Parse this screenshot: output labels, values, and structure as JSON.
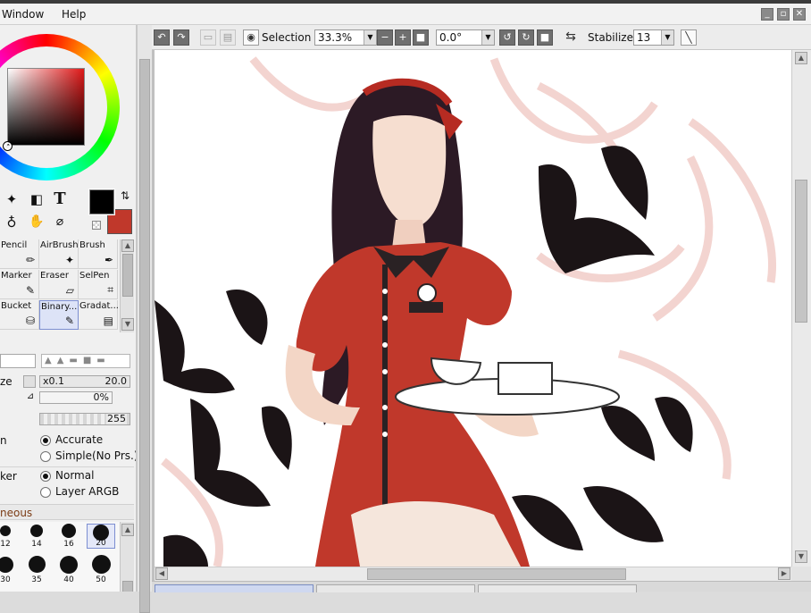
{
  "app": {
    "menu": [
      "Window",
      "Help"
    ],
    "window_buttons": [
      "_",
      "▫",
      "✕"
    ]
  },
  "toolbar": {
    "selection_label": "Selection",
    "zoom": "33.3%",
    "rotation": "0.0°",
    "stabilizer_label": "Stabilizer",
    "stabilizer_value": "13"
  },
  "tools": {
    "text_tool": "T",
    "tiles": [
      {
        "label": "Pencil",
        "icon": "✏"
      },
      {
        "label": "AirBrush",
        "icon": "✦"
      },
      {
        "label": "Brush",
        "icon": "✒"
      },
      {
        "label": "Marker",
        "icon": "✎"
      },
      {
        "label": "Eraser",
        "icon": "▱"
      },
      {
        "label": "SelPen",
        "icon": "⌗"
      },
      {
        "label": "Bucket",
        "icon": "⛁"
      },
      {
        "label": "Binary...",
        "icon": "✎"
      },
      {
        "label": "Gradat...",
        "icon": "▤"
      }
    ]
  },
  "brush_settings": {
    "size_label": "ze",
    "size_multiplier": "x0.1",
    "size_value": "20.0",
    "min_size_value": "0%",
    "density_value": "255",
    "blending_label": "n",
    "blending_options": [
      "Accurate",
      "Simple(No Prs.)"
    ],
    "mode_label": "ker",
    "mode_options": [
      "Normal",
      "Layer ARGB"
    ],
    "section_label": "neous"
  },
  "brush_sizes": {
    "row1": [
      "12",
      "14",
      "16",
      "20"
    ],
    "row2": [
      "30",
      "35",
      "40",
      "50"
    ]
  },
  "colors": {
    "primary": "#000000",
    "secondary": "#c0382b",
    "accent": "#7c8ed1"
  }
}
